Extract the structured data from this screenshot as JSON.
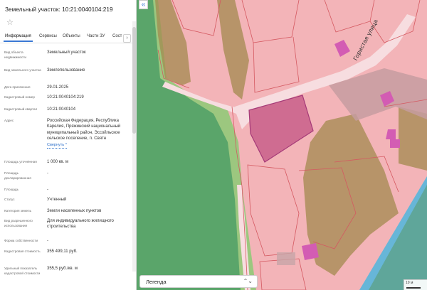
{
  "panel": {
    "title": "Земельный участок: 10:21:0040104:219",
    "tabs": [
      "Информация",
      "Сервисы",
      "Объекты",
      "Части ЗУ",
      "Сост"
    ],
    "tabs_next": "›",
    "rows": [
      {
        "label": "Вид объекта недвижимости",
        "value": "Земельный участок"
      },
      {
        "label": "Вид земельного участка",
        "value": "Землепользование"
      },
      {
        "label": "Дата присвоения",
        "value": "29.01.2025"
      },
      {
        "label": "Кадастровый номер",
        "value": "10:21:0040104:219"
      },
      {
        "label": "Кадастровый квартал",
        "value": "10:21:0040104"
      },
      {
        "label": "Адрес",
        "value": "Российская Федерация, Республика Карелия, Пряжинский национальный муниципальный район, Эссойльское сельское поселение, п. Святн",
        "link": "Свернуть ^"
      },
      {
        "label": "Площадь уточнённая",
        "value": "1 000 кв. м"
      },
      {
        "label": "Площадь декларированная",
        "value": "-"
      },
      {
        "label": "Площадь",
        "value": "-"
      },
      {
        "label": "Статус",
        "value": "Учтенный"
      },
      {
        "label": "Категория земель",
        "value": "Земли населенных пунктов"
      },
      {
        "label": "Вид разрешенного использования",
        "value": "Для индивидуального жилищного строительства"
      },
      {
        "label": "Форма собственности",
        "value": "-"
      },
      {
        "label": "Кадастровая стоимость",
        "value": "355 499,11 руб."
      },
      {
        "label": "Удельный показатель кадастровой стоимости",
        "value": "355,5 руб./кв. м"
      }
    ]
  },
  "map": {
    "collapse": "«",
    "street": "Гористая улица",
    "legend": "Легенда",
    "legend_chevron": "⌃⌄",
    "zoom_text": "10 м"
  },
  "colors": {
    "parcel": "#f3b4b8",
    "selected": "#cf6c91",
    "forest": "#5aa56a",
    "meadow": "#9cc77f",
    "water": "#67b6d8",
    "building": "#d35cb3",
    "road": "#f7dde0"
  }
}
